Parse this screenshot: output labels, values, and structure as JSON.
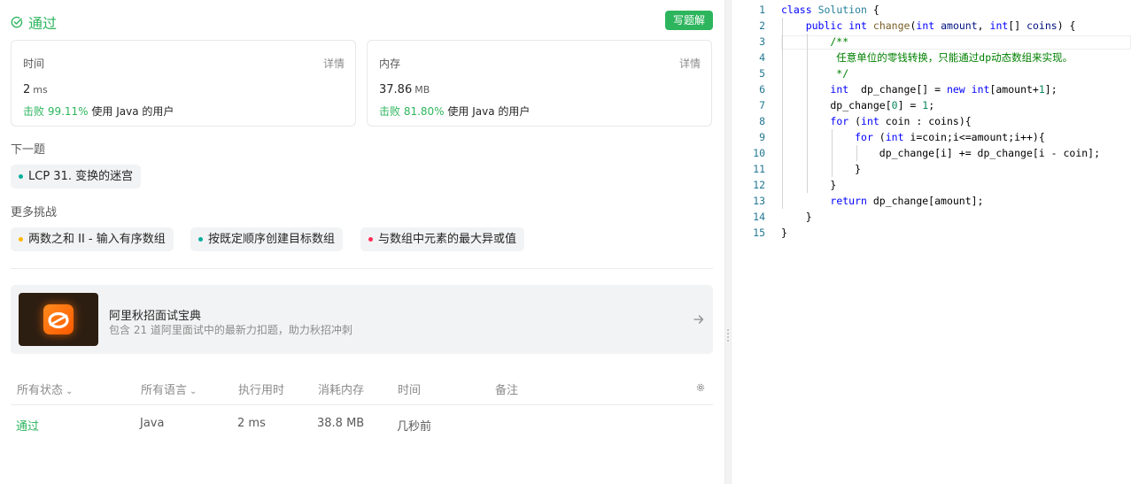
{
  "status": {
    "title": "通过",
    "write_solution": "写题解"
  },
  "time_card": {
    "label": "时间",
    "detail": "详情",
    "value": "2",
    "unit": "ms",
    "beat_pct": "击败 99.11%",
    "beat_text": " 使用 Java 的用户"
  },
  "memory_card": {
    "label": "内存",
    "detail": "详情",
    "value": "37.86",
    "unit": "MB",
    "beat_pct": "击败 81.80%",
    "beat_text": " 使用 Java 的用户"
  },
  "next": {
    "label": "下一题",
    "problem": "LCP 31. 变换的迷宫",
    "dot_color": "#00af9b"
  },
  "more": {
    "label": "更多挑战",
    "items": [
      {
        "text": "两数之和 II - 输入有序数组",
        "dot_color": "#ffb800"
      },
      {
        "text": "按既定顺序创建目标数组",
        "dot_color": "#00af9b"
      },
      {
        "text": "与数组中元素的最大异或值",
        "dot_color": "#ff2d55"
      }
    ]
  },
  "promo": {
    "title": "阿里秋招面试宝典",
    "subtitle": "包含 21 道阿里面试中的最新力扣题，助力秋招冲刺",
    "logo_glyph": "a",
    "arrow_icon": "arrow-right-icon"
  },
  "table": {
    "headers": {
      "status": "所有状态",
      "language": "所有语言",
      "runtime": "执行用时",
      "memory": "消耗内存",
      "time": "时间",
      "note": "备注"
    },
    "rows": [
      {
        "status": "通过",
        "language": "Java",
        "runtime": "2 ms",
        "memory": "38.8 MB",
        "time": "几秒前",
        "note": ""
      }
    ]
  },
  "code": {
    "line_numbers": [
      "1",
      "2",
      "3",
      "4",
      "5",
      "6",
      "7",
      "8",
      "9",
      "10",
      "11",
      "12",
      "13",
      "14",
      "15"
    ]
  },
  "colors": {
    "accent": "#2db55d"
  }
}
